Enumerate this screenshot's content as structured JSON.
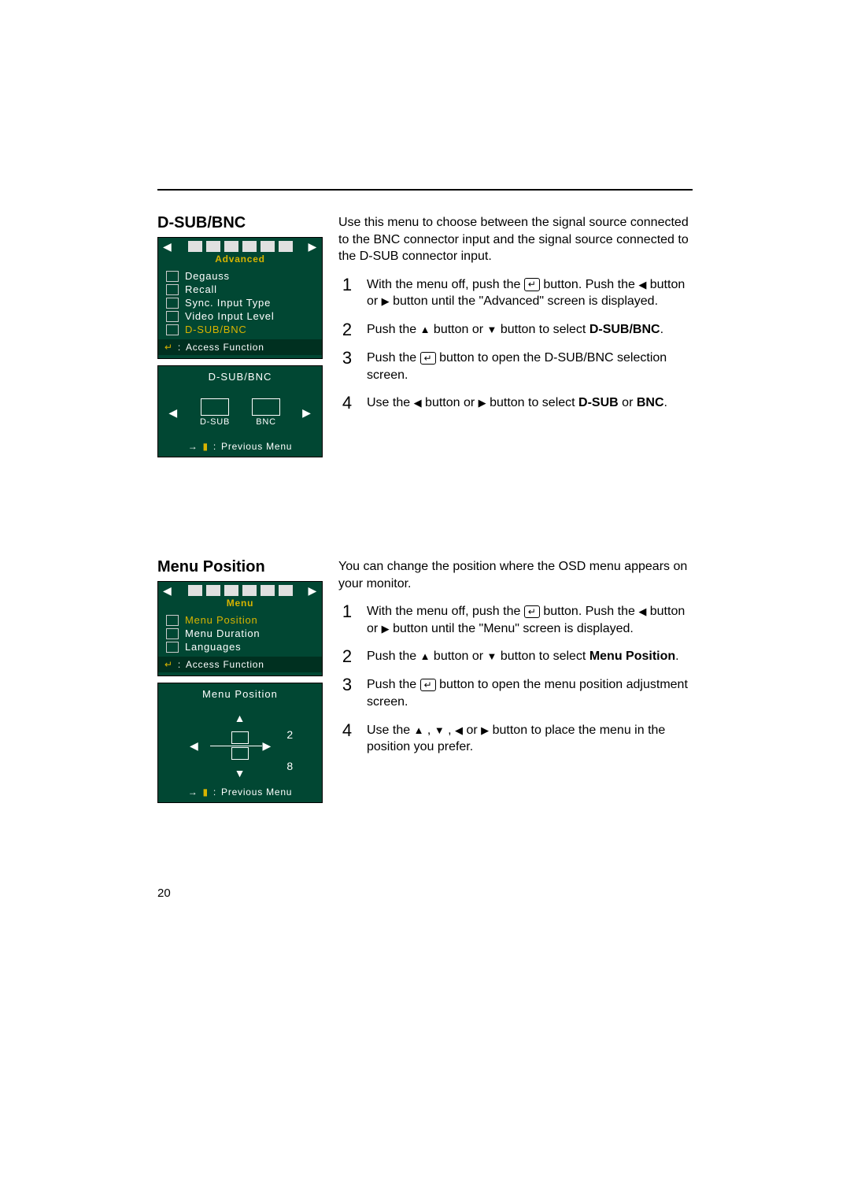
{
  "page_number": "20",
  "section1": {
    "title": "D-SUB/BNC",
    "intro": "Use this menu to choose between the signal source connected to the BNC connector input and the signal source connected to the D-SUB connector input.",
    "osd": {
      "title": "Advanced",
      "items": [
        "Degauss",
        "Recall",
        "Sync. Input Type",
        "Video Input Level",
        "D-SUB/BNC"
      ],
      "footer_key": "↵",
      "footer_label": "Access Function"
    },
    "subpanel": {
      "title": "D-SUB/BNC",
      "left": "D-SUB",
      "right": "BNC",
      "prev": "Previous Menu"
    },
    "steps": [
      {
        "sym": "1",
        "text_a": "With the menu off, push the ",
        "text_b": " button. Push the ",
        "text_c": " button or ",
        "text_d": " button until the \"Advanced\" screen is displayed."
      },
      {
        "sym": "2",
        "text_a": "Push the ",
        "text_b": " button or ",
        "text_c": " button to select ",
        "bold": "D-SUB/BNC",
        "text_d": "."
      },
      {
        "sym": "3",
        "text_a": "Push the ",
        "text_b": " button to open the D-SUB/BNC selection screen."
      },
      {
        "sym": "4",
        "text_a": "Use the ",
        "text_b": " button or ",
        "text_c": " button to select ",
        "bold1": "D-SUB",
        "mid": " or ",
        "bold2": "BNC",
        "end": "."
      }
    ]
  },
  "section2": {
    "title": "Menu Position",
    "intro": "You can change the position where the OSD menu appears on your monitor.",
    "osd": {
      "title": "Menu",
      "items": [
        "Menu Position",
        "Menu Duration",
        "Languages"
      ],
      "footer_key": "↵",
      "footer_label": "Access Function"
    },
    "subpanel": {
      "title": "Menu Position",
      "h": "2",
      "v": "8",
      "prev": "Previous Menu"
    },
    "steps": [
      {
        "sym": "1",
        "text_a": "With the menu off, push the ",
        "text_b": " button. Push the ",
        "text_c": " button or ",
        "text_d": " button until the \"Menu\" screen is displayed."
      },
      {
        "sym": "2",
        "text_a": "Push the ",
        "text_b": " button or ",
        "text_c": " button to select ",
        "bold": "Menu Position",
        "text_d": "."
      },
      {
        "sym": "3",
        "text_a": "Push the ",
        "text_b": " button to open the menu position adjustment screen."
      },
      {
        "sym": "4",
        "text_a": "Use the ",
        "text_b": " , ",
        "text_c": " , ",
        "text_d": " or ",
        "text_e": " button to place the menu in the position you prefer."
      }
    ]
  }
}
